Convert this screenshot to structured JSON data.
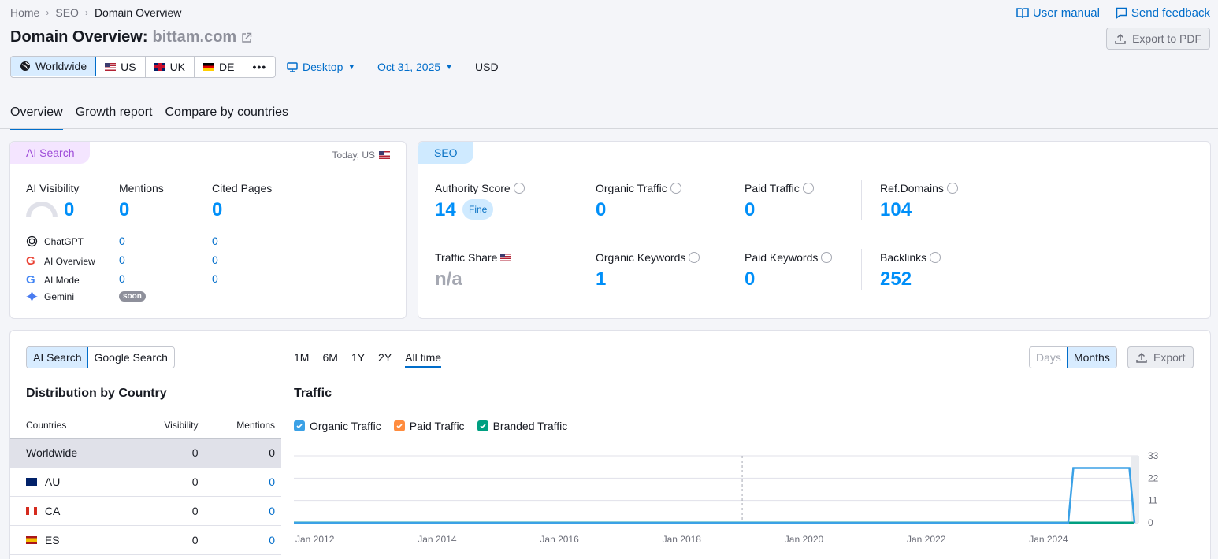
{
  "breadcrumb": {
    "home": "Home",
    "seo": "SEO",
    "current": "Domain Overview"
  },
  "toplinks": {
    "manual": "User manual",
    "feedback": "Send feedback"
  },
  "title": {
    "prefix": "Domain Overview:",
    "domain": "bittam.com"
  },
  "export_pdf": "Export to PDF",
  "databases": [
    {
      "label": "Worldwide",
      "active": true
    },
    {
      "label": "US"
    },
    {
      "label": "UK"
    },
    {
      "label": "DE"
    }
  ],
  "device": "Desktop",
  "date": "Oct 31, 2025",
  "currency": "USD",
  "tabs": [
    "Overview",
    "Growth report",
    "Compare by countries"
  ],
  "ai_card": {
    "pill": "AI Search",
    "when": "Today, US",
    "metrics": [
      {
        "label": "AI Visibility",
        "value": "0"
      },
      {
        "label": "Mentions",
        "value": "0"
      },
      {
        "label": "Cited Pages",
        "value": "0"
      }
    ],
    "rows": [
      {
        "label": "ChatGPT",
        "mentions": "0",
        "cited": "0"
      },
      {
        "label": "AI Overview",
        "mentions": "0",
        "cited": "0"
      },
      {
        "label": "AI Mode",
        "mentions": "0",
        "cited": "0"
      },
      {
        "label": "Gemini",
        "badge": "soon"
      }
    ]
  },
  "seo_card": {
    "pill": "SEO",
    "authority": {
      "label": "Authority Score",
      "value": "14",
      "badge": "Fine"
    },
    "organic_traffic": {
      "label": "Organic Traffic",
      "value": "0"
    },
    "paid_traffic": {
      "label": "Paid Traffic",
      "value": "0"
    },
    "ref_domains": {
      "label": "Ref.Domains",
      "value": "104"
    },
    "traffic_share": {
      "label": "Traffic Share",
      "value": "n/a"
    },
    "organic_keywords": {
      "label": "Organic Keywords",
      "value": "1"
    },
    "paid_keywords": {
      "label": "Paid Keywords",
      "value": "0"
    },
    "backlinks": {
      "label": "Backlinks",
      "value": "252"
    }
  },
  "bottom": {
    "search_toggle": [
      "AI Search",
      "Google Search"
    ],
    "periods": [
      "1M",
      "6M",
      "1Y",
      "2Y",
      "All time"
    ],
    "granularity": [
      "Days",
      "Months"
    ],
    "export": "Export",
    "dist_title": "Distribution by Country",
    "table_headers": [
      "Countries",
      "Visibility",
      "Mentions"
    ],
    "table_rows": [
      {
        "country": "Worldwide",
        "visibility": "0",
        "mentions": "0"
      },
      {
        "country": "AU",
        "visibility": "0",
        "mentions": "0"
      },
      {
        "country": "CA",
        "visibility": "0",
        "mentions": "0"
      },
      {
        "country": "ES",
        "visibility": "0",
        "mentions": "0"
      }
    ],
    "traffic_title": "Traffic",
    "legend": [
      "Organic Traffic",
      "Paid Traffic",
      "Branded Traffic"
    ]
  },
  "colors": {
    "accent": "#006dca",
    "organic": "#3ba1e6",
    "paid": "#ff8c3e",
    "branded": "#009f81"
  },
  "chart_data": {
    "type": "line",
    "x_tick_labels": [
      "Jan 2012",
      "Jan 2014",
      "Jan 2016",
      "Jan 2018",
      "Jan 2020",
      "Jan 2022",
      "Jan 2024"
    ],
    "y_tick_labels": [
      "0",
      "11",
      "22",
      "33"
    ],
    "ylim": [
      0,
      33
    ],
    "xlim": [
      "2012-01",
      "2025-10"
    ],
    "series": [
      {
        "name": "Organic Traffic",
        "points": [
          [
            "2012-01",
            0
          ],
          [
            "2024-09",
            0
          ],
          [
            "2024-10",
            27
          ],
          [
            "2025-09",
            27
          ],
          [
            "2025-10",
            0
          ]
        ]
      },
      {
        "name": "Branded Traffic",
        "points": [
          [
            "2012-01",
            0
          ],
          [
            "2025-10",
            0
          ]
        ]
      }
    ],
    "marker_date": "2019-05",
    "grid": true
  }
}
